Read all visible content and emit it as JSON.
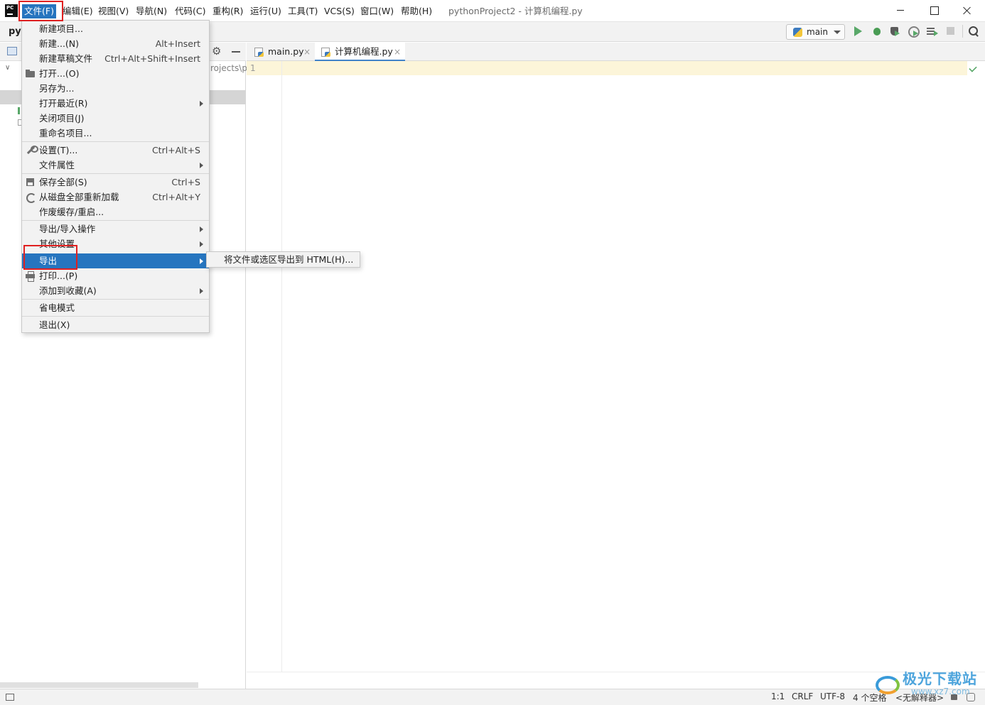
{
  "app": {
    "logo_text": "PC",
    "window_title": "pythonProject2 - 计算机编程.py"
  },
  "menubar": {
    "items": [
      "文件(F)",
      "编辑(E)",
      "视图(V)",
      "导航(N)",
      "代码(C)",
      "重构(R)",
      "运行(U)",
      "工具(T)",
      "VCS(S)",
      "窗口(W)",
      "帮助(H)"
    ],
    "active": "文件(F)"
  },
  "toolbar": {
    "project_crumb": "py",
    "run_config": "main",
    "icons": [
      "run-icon",
      "debug-icon",
      "coverage-icon",
      "profile-icon",
      "concurrency-icon",
      "stop-icon",
      "search-icon"
    ]
  },
  "project_panel": {
    "path_fragment": "rojects\\p"
  },
  "editor": {
    "tabs": [
      {
        "label": "main.py",
        "close": "×"
      },
      {
        "label": "计算机编程.py",
        "close": "×"
      }
    ],
    "active_tab": "计算机编程.py",
    "line_number": "1"
  },
  "file_menu": {
    "items": [
      {
        "label": "新建项目...",
        "shortcut": ""
      },
      {
        "label": "新建...(N)",
        "shortcut": "Alt+Insert"
      },
      {
        "label": "新建草稿文件",
        "shortcut": "Ctrl+Alt+Shift+Insert"
      },
      {
        "label": "打开...(O)",
        "shortcut": "",
        "icon": "folder-icon"
      },
      {
        "label": "另存为...",
        "shortcut": ""
      },
      {
        "label": "打开最近(R)",
        "shortcut": "",
        "submenu": true
      },
      {
        "label": "关闭项目(J)",
        "shortcut": ""
      },
      {
        "label": "重命名项目...",
        "shortcut": ""
      },
      {
        "label": "设置(T)...",
        "shortcut": "Ctrl+Alt+S",
        "icon": "wrench-icon"
      },
      {
        "label": "文件属性",
        "shortcut": "",
        "submenu": true
      },
      {
        "label": "保存全部(S)",
        "shortcut": "Ctrl+S",
        "icon": "save-icon"
      },
      {
        "label": "从磁盘全部重新加载",
        "shortcut": "Ctrl+Alt+Y",
        "icon": "reload-icon"
      },
      {
        "label": "作废缓存/重启...",
        "shortcut": ""
      },
      {
        "label": "导出/导入操作",
        "shortcut": "",
        "submenu": true
      },
      {
        "label": "其他设置",
        "shortcut": "",
        "submenu": true
      },
      {
        "label": "导出",
        "shortcut": "",
        "submenu": true,
        "highlighted": true
      },
      {
        "label": "打印...(P)",
        "shortcut": "",
        "icon": "print-icon"
      },
      {
        "label": "添加到收藏(A)",
        "shortcut": "",
        "submenu": true
      },
      {
        "label": "省电模式",
        "shortcut": ""
      },
      {
        "label": "退出(X)",
        "shortcut": ""
      }
    ]
  },
  "export_submenu": {
    "items": [
      "将文件或选区导出到 HTML(H)..."
    ]
  },
  "statusbar": {
    "position": "1:1",
    "line_separator": "CRLF",
    "encoding": "UTF-8",
    "indent": "4 个空格",
    "interpreter": "<无解释器>"
  },
  "watermark": {
    "text": "极光下载站",
    "url": "www.xz7.com"
  },
  "colors": {
    "accent": "#2675bf",
    "highlight_box": "#e02020",
    "current_line": "#fcf5d9",
    "run_green": "#59a869"
  }
}
